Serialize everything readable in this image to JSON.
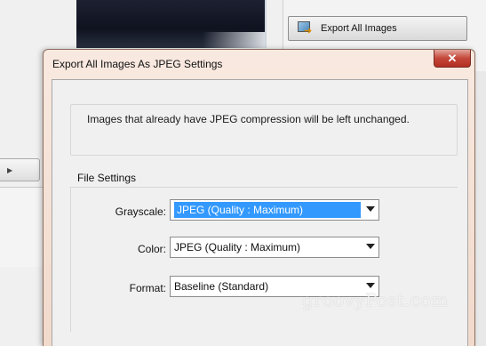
{
  "background": {
    "export_button_label": "Export All Images",
    "left_button_icon": "arrow-right-icon",
    "export_icon": "export-images-icon"
  },
  "dialog": {
    "title": "Export All Images As JPEG Settings",
    "close_glyph": "✕",
    "info_text": "Images that already have JPEG compression will be left unchanged.",
    "file_settings": {
      "group_title": "File Settings",
      "grayscale_label": "Grayscale:",
      "grayscale_value": "JPEG (Quality : Maximum)",
      "color_label": "Color:",
      "color_value": "JPEG (Quality : Maximum)",
      "format_label": "Format:",
      "format_value": "Baseline (Standard)"
    }
  },
  "watermark": "groovyPost.com",
  "colors": {
    "selection": "#3399ff",
    "close_button": "#c4473a",
    "dialog_frame": "#f1d9cb"
  }
}
